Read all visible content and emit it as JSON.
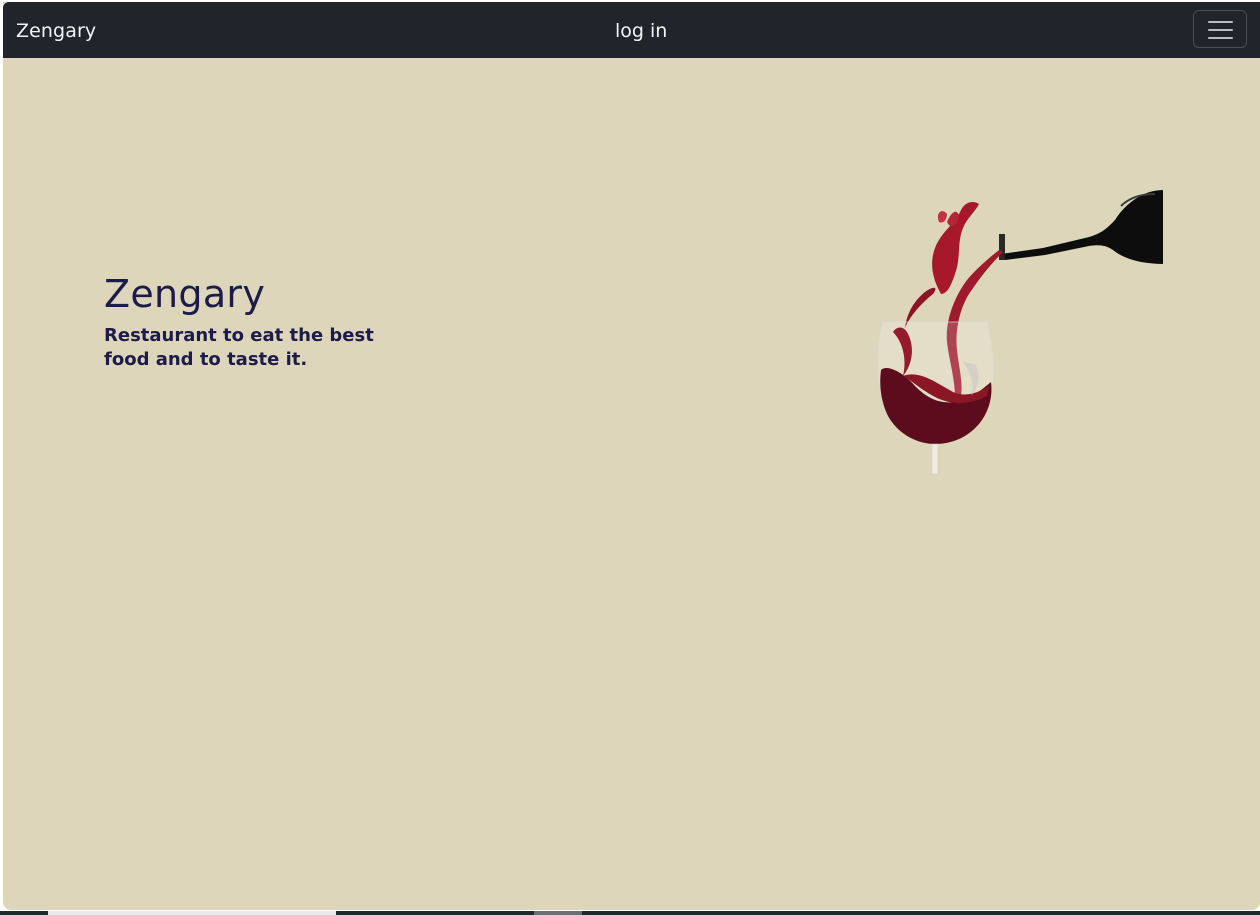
{
  "navbar": {
    "brand": "Zengary",
    "login_label": "log in",
    "menu_icon": "hamburger-menu-icon"
  },
  "hero": {
    "title": "Zengary",
    "subtitle": "Restaurant to eat the best food and to taste it.",
    "image": "wine-pouring-image"
  },
  "colors": {
    "navbar_bg": "#21252b",
    "page_bg": "#ded6bb",
    "heading": "#1d1b49",
    "wine": "#8b1a2a"
  }
}
